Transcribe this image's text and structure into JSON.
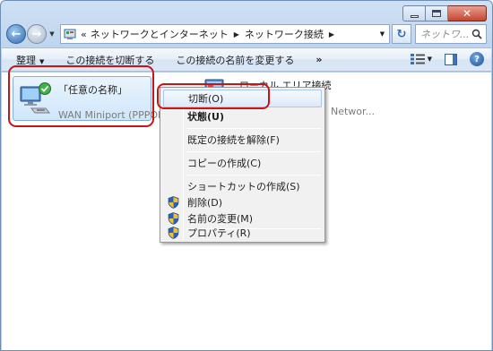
{
  "titlebar": {
    "buttons": [
      "minimize",
      "maximize",
      "close"
    ]
  },
  "address_bar": {
    "overflow": "«",
    "crumbs": [
      "ネットワークとインターネット",
      "ネットワーク接続"
    ],
    "search_placeholder": "ネットワ..."
  },
  "toolbar": {
    "organize": "整理",
    "disconnect": "この接続を切断する",
    "rename": "この接続の名前を変更する",
    "more": "»"
  },
  "connections": [
    {
      "name": "「任意の名称」",
      "device": "WAN Miniport (PPPOE)",
      "selected": true
    },
    {
      "name": "ローカル エリア接続",
      "device": "Networ..."
    }
  ],
  "context_menu": {
    "items": [
      {
        "label": "切断(O)",
        "bold": false,
        "highlighted": true,
        "shield": false
      },
      {
        "label": "状態(U)",
        "bold": true,
        "highlighted": false,
        "shield": false
      },
      {
        "label": "既定の接続を解除(F)",
        "bold": false,
        "highlighted": false,
        "shield": false
      },
      {
        "label": "コピーの作成(C)",
        "bold": false,
        "highlighted": false,
        "shield": false
      },
      {
        "label": "ショートカットの作成(S)",
        "bold": false,
        "highlighted": false,
        "shield": false
      },
      {
        "label": "削除(D)",
        "bold": false,
        "highlighted": false,
        "shield": true
      },
      {
        "label": "名前の変更(M)",
        "bold": false,
        "highlighted": false,
        "shield": true
      },
      {
        "label": "プロパティ(R)",
        "bold": false,
        "highlighted": false,
        "shield": true
      }
    ]
  },
  "colors": {
    "highlight_box": "#cc1313",
    "selection": "#cfe6fb"
  }
}
